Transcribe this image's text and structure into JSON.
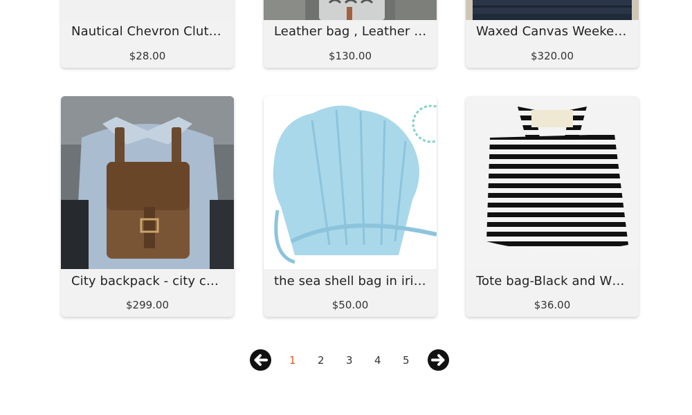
{
  "products": [
    {
      "title": "Nautical Chevron Clutch - Navy Blue",
      "price": "$28.00",
      "image": "chevron-clutch-photo"
    },
    {
      "title": "Leather bag , Leather handbag",
      "price": "$130.00",
      "image": "leather-bag-photo"
    },
    {
      "title": "Waxed Canvas Weekender Bag",
      "price": "$320.00",
      "image": "canvas-weekender-photo"
    },
    {
      "title": "City backpack - city camel leather",
      "price": "$299.00",
      "image": "leather-backpack-photo"
    },
    {
      "title": "the sea shell bag in iridescent blue",
      "price": "$50.00",
      "image": "seashell-bag-photo"
    },
    {
      "title": "Tote bag-Black and White Stripes",
      "price": "$36.00",
      "image": "striped-tote-photo"
    }
  ],
  "pagination": {
    "prev_icon": "arrow-left-icon",
    "next_icon": "arrow-right-icon",
    "pages": [
      "1",
      "2",
      "3",
      "4",
      "5"
    ],
    "current": "1",
    "colors": {
      "current": "#e2562a",
      "default": "#333333"
    }
  }
}
